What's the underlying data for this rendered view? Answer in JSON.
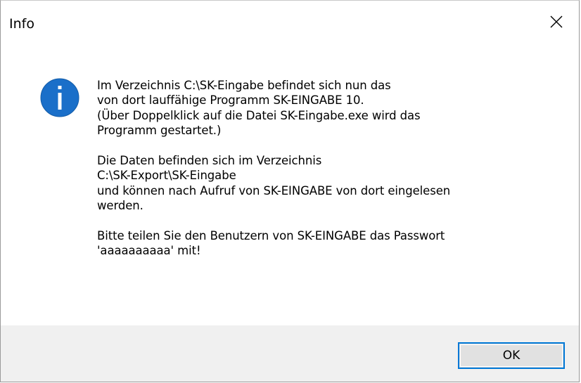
{
  "window": {
    "title": "Info"
  },
  "dialog": {
    "icon": "info-icon",
    "lines": [
      "Im Verzeichnis C:\\SK-Eingabe befindet sich nun das",
      "von dort lauffähige Programm SK-EINGABE 10.",
      "(Über Doppelklick auf die Datei SK-Eingabe.exe wird das",
      "Programm gestartet.)",
      "",
      "Die Daten befinden sich im Verzeichnis",
      "C:\\SK-Export\\SK-Eingabe",
      "und können nach Aufruf von SK-EINGABE von dort eingelesen",
      "werden.",
      "",
      "Bitte teilen Sie den Benutzern von SK-EINGABE das Passwort",
      "'aaaaaaaaaa' mit!"
    ]
  },
  "buttons": {
    "ok_label": "OK",
    "close_icon": "close-icon"
  },
  "colors": {
    "info_icon_fill": "#1a6fc9",
    "button_focus_border": "#0078d7",
    "footer_background": "#f0f0f0"
  }
}
